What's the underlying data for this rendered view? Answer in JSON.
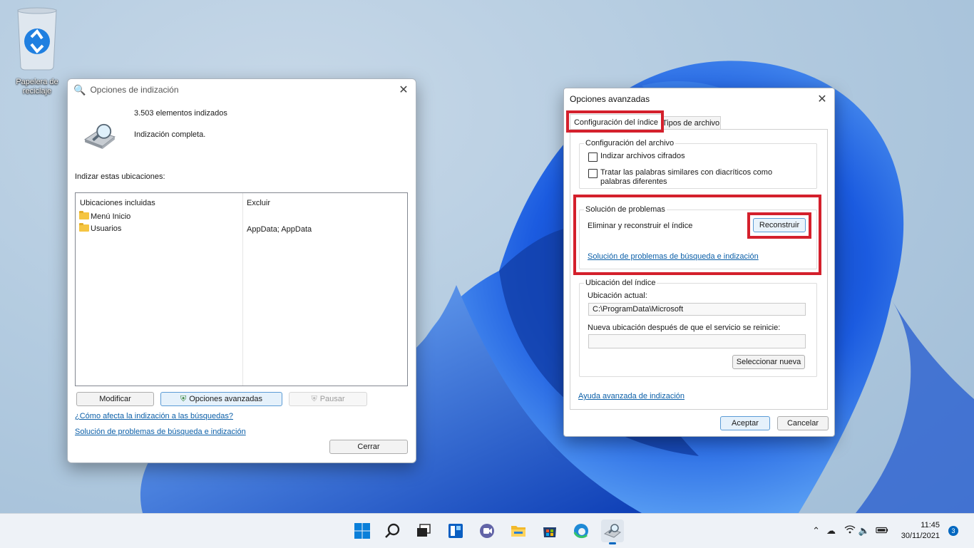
{
  "desktop": {
    "recycle_bin_label": "Papelera de reciclaje"
  },
  "indexing_window": {
    "title": "Opciones de indización",
    "item_count": "3.503 elementos indizados",
    "status": "Indización completa.",
    "locations_label": "Indizar estas ubicaciones:",
    "columns": [
      "Ubicaciones incluidas",
      "Excluir"
    ],
    "rows": [
      {
        "location": "Menú Inicio",
        "exclude": ""
      },
      {
        "location": "Usuarios",
        "exclude": "AppData; AppData"
      }
    ],
    "buttons": {
      "modify": "Modificar",
      "advanced": "Opciones avanzadas",
      "pause": "Pausar",
      "close": "Cerrar"
    },
    "links": {
      "how_affects": "¿Cómo afecta la indización a las búsquedas?",
      "troubleshoot": "Solución de problemas de búsqueda e indización"
    }
  },
  "advanced_window": {
    "title": "Opciones avanzadas",
    "tabs": [
      "Configuración del índice",
      "Tipos de archivo"
    ],
    "file_settings": {
      "label": "Configuración del archivo",
      "encrypt": "Indizar archivos cifrados",
      "diacritics": "Tratar las palabras similares con diacríticos como palabras diferentes"
    },
    "troubleshooting": {
      "label": "Solución de problemas",
      "rebuild_text": "Eliminar y reconstruir el índice",
      "rebuild_button": "Reconstruir",
      "link": "Solución de problemas de búsqueda e indización"
    },
    "index_location": {
      "label": "Ubicación del índice",
      "current_label": "Ubicación actual:",
      "current_value": "C:\\ProgramData\\Microsoft",
      "new_label": "Nueva ubicación después de que el servicio se reinicie:",
      "new_value": "",
      "select_new": "Seleccionar nueva"
    },
    "help_link": "Ayuda avanzada de indización",
    "ok": "Aceptar",
    "cancel": "Cancelar"
  },
  "taskbar": {
    "icons": [
      "start-icon",
      "search-icon",
      "task-view-icon",
      "widgets-icon",
      "chat-icon",
      "file-explorer-icon",
      "store-icon",
      "edge-icon",
      "indexing-options-icon"
    ],
    "time": "11:45",
    "date": "30/11/2021",
    "notifications": "3"
  },
  "colors": {
    "highlight": "#d4202c",
    "accent": "#0067c0",
    "link": "#0b5fa8"
  }
}
